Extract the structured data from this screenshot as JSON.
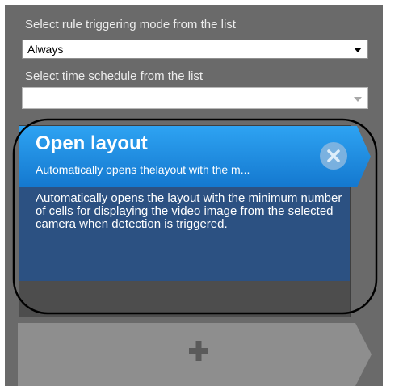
{
  "trigger_mode": {
    "label": "Select rule triggering mode from the list",
    "selected": "Always"
  },
  "schedule": {
    "label": "Select time schedule from the list",
    "selected": ""
  },
  "action_card": {
    "title": "Open layout",
    "subtitle": "Automatically opens thelayout with the m...",
    "description": "Automatically opens the layout with the minimum number of cells for displaying the video image from the selected camera when detection is triggered.",
    "close_icon": "close-icon"
  },
  "add_action": {
    "icon": "plus-icon"
  },
  "colors": {
    "panel_bg": "#6a6a6a",
    "card_header": "#1f8fe0",
    "card_body": "#2c5182",
    "add_tile": "#8e8e8e"
  }
}
